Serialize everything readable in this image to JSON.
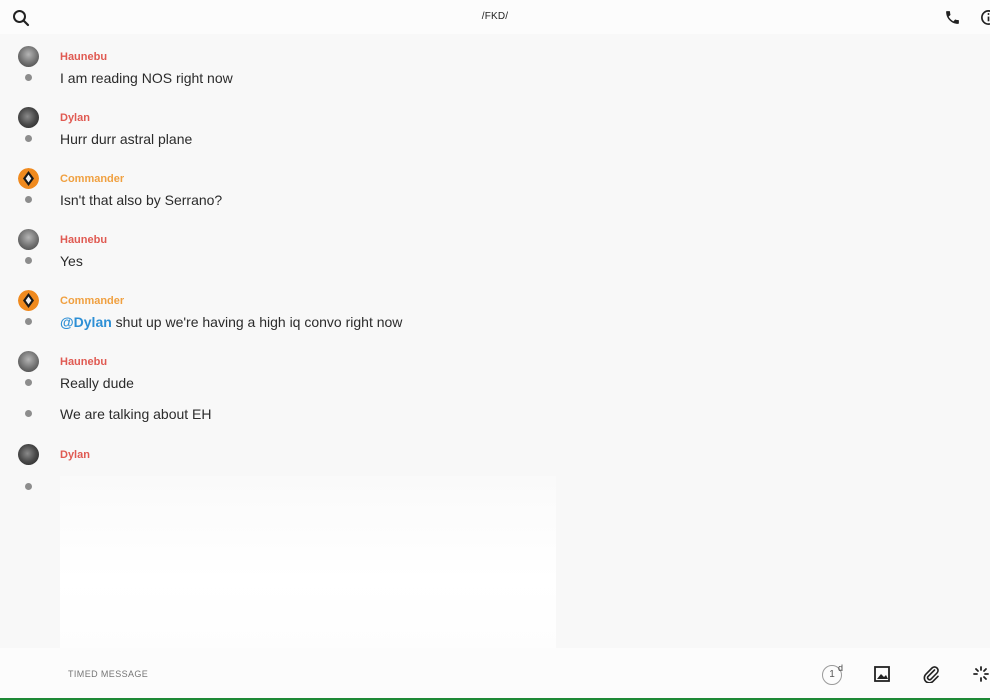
{
  "header": {
    "title": "/FKD/",
    "icons": [
      "search-icon",
      "phone-icon",
      "info-icon"
    ]
  },
  "messages": [
    {
      "author": "Haunebu",
      "author_color": "#e05a52",
      "avatar": "haunebu-avatar",
      "text": "I am reading NOS right now"
    },
    {
      "author": "Dylan",
      "author_color": "#e05a52",
      "avatar": "dylan-avatar",
      "text": "Hurr durr astral plane"
    },
    {
      "author": "Commander",
      "author_color": "#f0a040",
      "avatar": "commander-avatar",
      "text": "Isn't that also by Serrano?"
    },
    {
      "author": "Haunebu",
      "author_color": "#e05a52",
      "avatar": "haunebu-avatar",
      "text": "Yes"
    },
    {
      "author": "Commander",
      "author_color": "#f0a040",
      "avatar": "commander-avatar",
      "mention": "@Dylan",
      "text": " shut up we're having a high iq convo right now"
    },
    {
      "author": "Haunebu",
      "author_color": "#e05a52",
      "avatar": "haunebu-avatar",
      "text": "Really dude"
    },
    {
      "text": "We are talking about EH"
    },
    {
      "author": "Dylan",
      "author_color": "#e05a52",
      "avatar": "dylan-avatar",
      "attachment": "image"
    }
  ],
  "composer": {
    "placeholder": "TIMED MESSAGE",
    "timer_value": "1",
    "timer_unit": "d",
    "icons": [
      "timer-icon",
      "image-icon",
      "attachment-icon",
      "more-icon"
    ]
  },
  "colors": {
    "accent_red": "#e05a52",
    "accent_orange": "#f0a040",
    "mention_blue": "#2d8fd5",
    "bottom_line": "#1e8a36"
  }
}
